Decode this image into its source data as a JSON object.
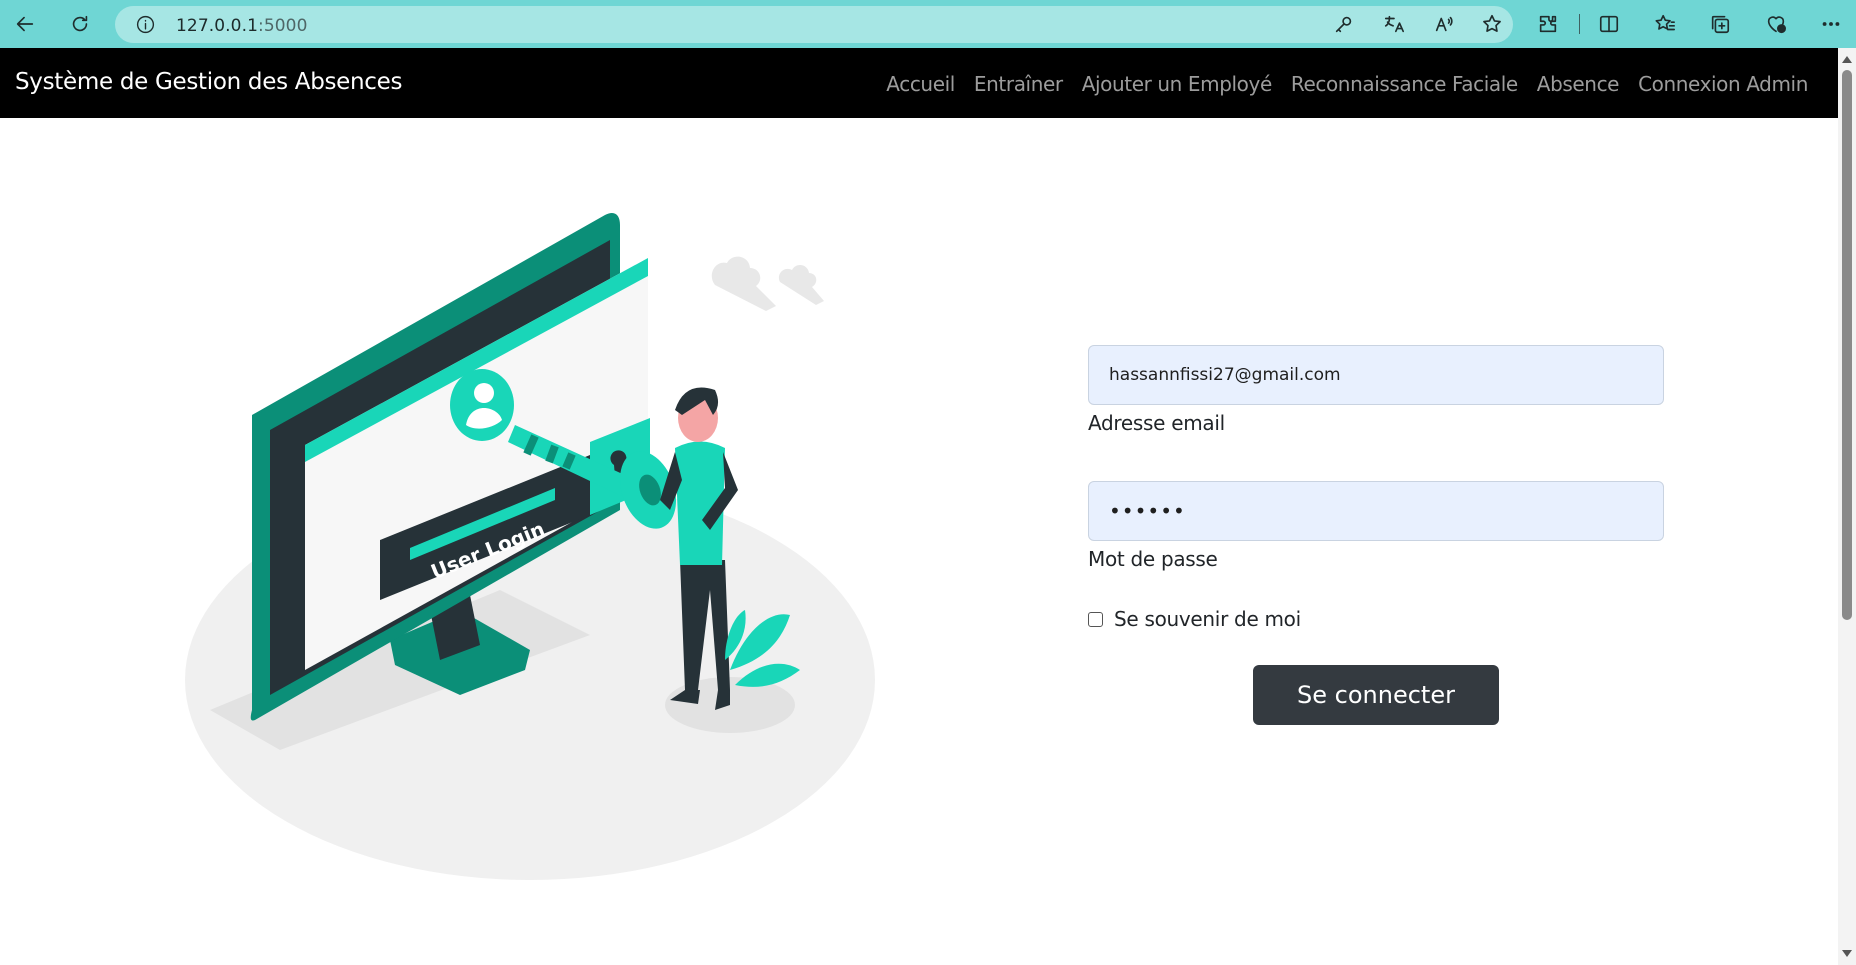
{
  "browser": {
    "url_host": "127.0.0.1",
    "url_port": ":5000",
    "icons": [
      "back-icon",
      "refresh-icon",
      "info-icon",
      "key-icon",
      "translate-icon",
      "read-aloud-icon",
      "favorite-star-icon",
      "extensions-icon",
      "split-screen-icon",
      "favorites-icon",
      "collections-icon",
      "browser-essentials-icon",
      "more-icon"
    ]
  },
  "navbar": {
    "brand": "Système de Gestion des Absences",
    "links": [
      "Accueil",
      "Entraîner",
      "Ajouter un Employé",
      "Reconnaissance Faciale",
      "Absence",
      "Connexion Admin"
    ]
  },
  "illustration": {
    "screen_text": "User Login",
    "colors": {
      "teal": "#19d6b8",
      "dark_teal": "#0b8f78",
      "dark": "#263238",
      "ground": "#ebebeb"
    }
  },
  "form": {
    "email_value": "hassannfissi27@gmail.com",
    "email_label": "Adresse email",
    "password_value": "••••••",
    "password_label": "Mot de passe",
    "remember_label": "Se souvenir de moi",
    "remember_checked": false,
    "submit_label": "Se connecter"
  },
  "colors": {
    "chrome": "#6fd6d4",
    "navbar": "#000000",
    "input_bg": "#e8f0fe",
    "button": "#343a40"
  }
}
